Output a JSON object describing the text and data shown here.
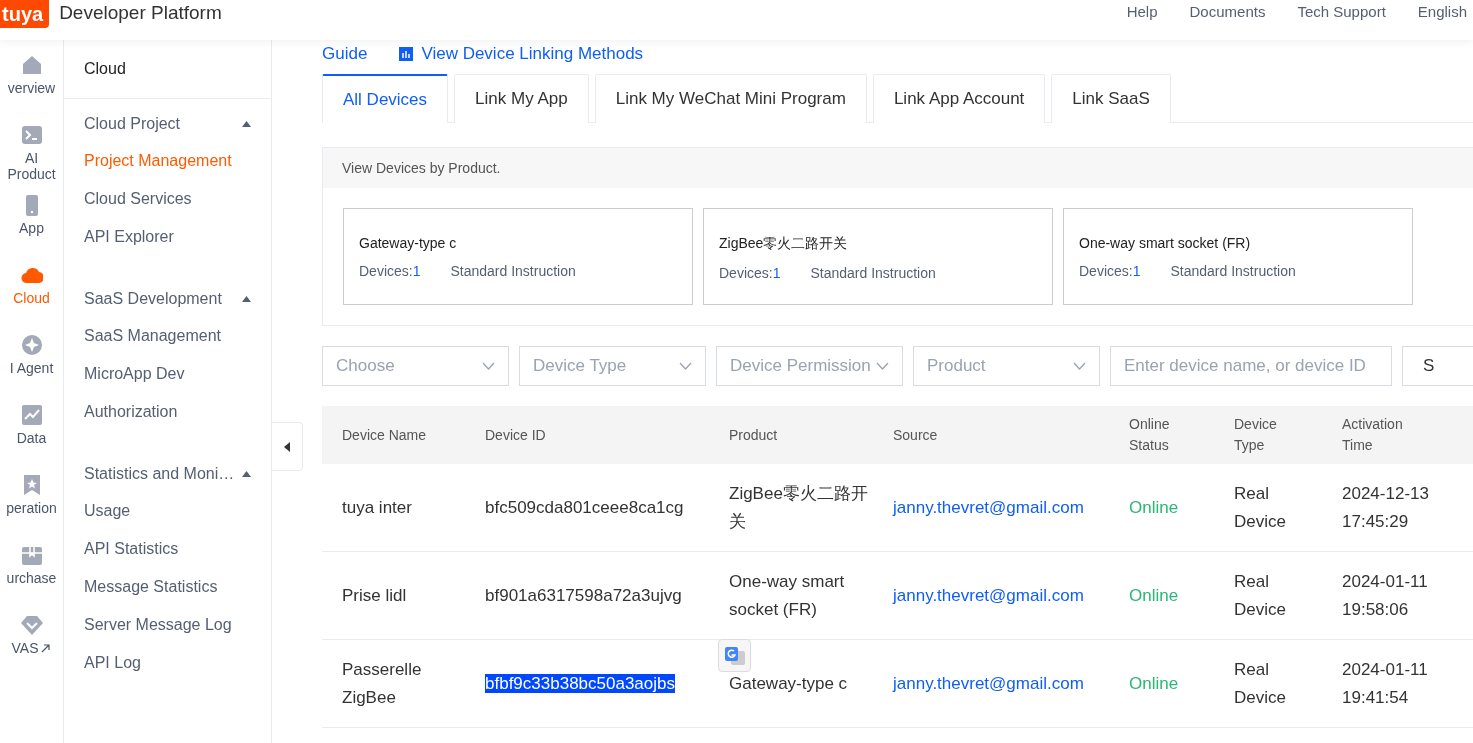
{
  "header": {
    "logo": "tuya",
    "title": "Developer Platform",
    "links": [
      "Help",
      "Documents",
      "Tech Support",
      "English"
    ]
  },
  "rail": [
    {
      "label": "verview",
      "selected": false
    },
    {
      "label": "AI Product",
      "selected": false
    },
    {
      "label": "App",
      "selected": false
    },
    {
      "label": "Cloud",
      "selected": true
    },
    {
      "label": "I Agent",
      "selected": false
    },
    {
      "label": "Data",
      "selected": false
    },
    {
      "label": "peration",
      "selected": false
    },
    {
      "label": "urchase",
      "selected": false
    },
    {
      "label": "VAS",
      "selected": false,
      "external": true
    }
  ],
  "sidebar": {
    "title": "Cloud",
    "groups": [
      {
        "label": "Cloud Project",
        "expanded": true,
        "items": [
          {
            "label": "Project Management",
            "selected": true
          },
          {
            "label": "Cloud Services",
            "selected": false
          },
          {
            "label": "API Explorer",
            "selected": false
          }
        ]
      },
      {
        "label": "SaaS Development",
        "expanded": true,
        "items": [
          {
            "label": "SaaS Management",
            "selected": false
          },
          {
            "label": "MicroApp Dev",
            "selected": false
          },
          {
            "label": "Authorization",
            "selected": false
          }
        ]
      },
      {
        "label": "Statistics and Moni…",
        "expanded": true,
        "items": [
          {
            "label": "Usage",
            "selected": false
          },
          {
            "label": "API Statistics",
            "selected": false
          },
          {
            "label": "Message Statistics",
            "selected": false
          },
          {
            "label": "Server Message Log",
            "selected": false
          },
          {
            "label": "API Log",
            "selected": false
          }
        ]
      }
    ]
  },
  "top_links": [
    "Guide",
    "View Device Linking Methods"
  ],
  "tabs": [
    {
      "label": "All Devices",
      "selected": true
    },
    {
      "label": "Link My App",
      "selected": false
    },
    {
      "label": "Link My WeChat Mini Program",
      "selected": false
    },
    {
      "label": "Link App Account",
      "selected": false
    },
    {
      "label": "Link SaaS",
      "selected": false
    }
  ],
  "products_panel": {
    "title": "View Devices by Product.",
    "cards": [
      {
        "name": "Gateway-type c",
        "devices_label": "Devices:",
        "devices_count": "1",
        "instruction": "Standard Instruction"
      },
      {
        "name": "ZigBee零火二路开关",
        "devices_label": "Devices:",
        "devices_count": "1",
        "instruction": "Standard Instruction"
      },
      {
        "name": "One-way smart socket (FR)",
        "devices_label": "Devices:",
        "devices_count": "1",
        "instruction": "Standard Instruction"
      }
    ]
  },
  "filters": [
    {
      "kind": "select",
      "placeholder": "Choose"
    },
    {
      "kind": "select",
      "placeholder": "Device Type"
    },
    {
      "kind": "select",
      "placeholder": "Device Permission"
    },
    {
      "kind": "select",
      "placeholder": "Product"
    },
    {
      "kind": "input",
      "placeholder": "Enter device name, or device ID"
    },
    {
      "kind": "button",
      "label": "S"
    }
  ],
  "table": {
    "columns": [
      "Device Name",
      "Device ID",
      "Product",
      "Source",
      "Online Status",
      "Device Type",
      "Activation Time"
    ],
    "rows": [
      {
        "name": "tuya inter",
        "id": "bfc509cda801ceee8ca1cg",
        "id_selected": false,
        "product": "ZigBee零火二路开关",
        "source": "janny.thevret@gmail.com",
        "status": "Online",
        "online": true,
        "type": "Real Device",
        "time": "2024-12-13 17:45:29"
      },
      {
        "name": "Prise lidl",
        "id": "bf901a6317598a72a3ujvg",
        "id_selected": false,
        "product": "One-way smart socket (FR)",
        "source": "janny.thevret@gmail.com",
        "status": "Online",
        "online": true,
        "type": "Real Device",
        "time": "2024-01-11 19:58:06"
      },
      {
        "name": "Passerelle ZigBee",
        "id": "bfbf9c33b38bc50a3aojbs",
        "id_selected": true,
        "product": "Gateway-type c",
        "source": "janny.thevret@gmail.com",
        "status": "Online",
        "online": true,
        "type": "Real Device",
        "time": "2024-01-11 19:41:54"
      }
    ]
  }
}
